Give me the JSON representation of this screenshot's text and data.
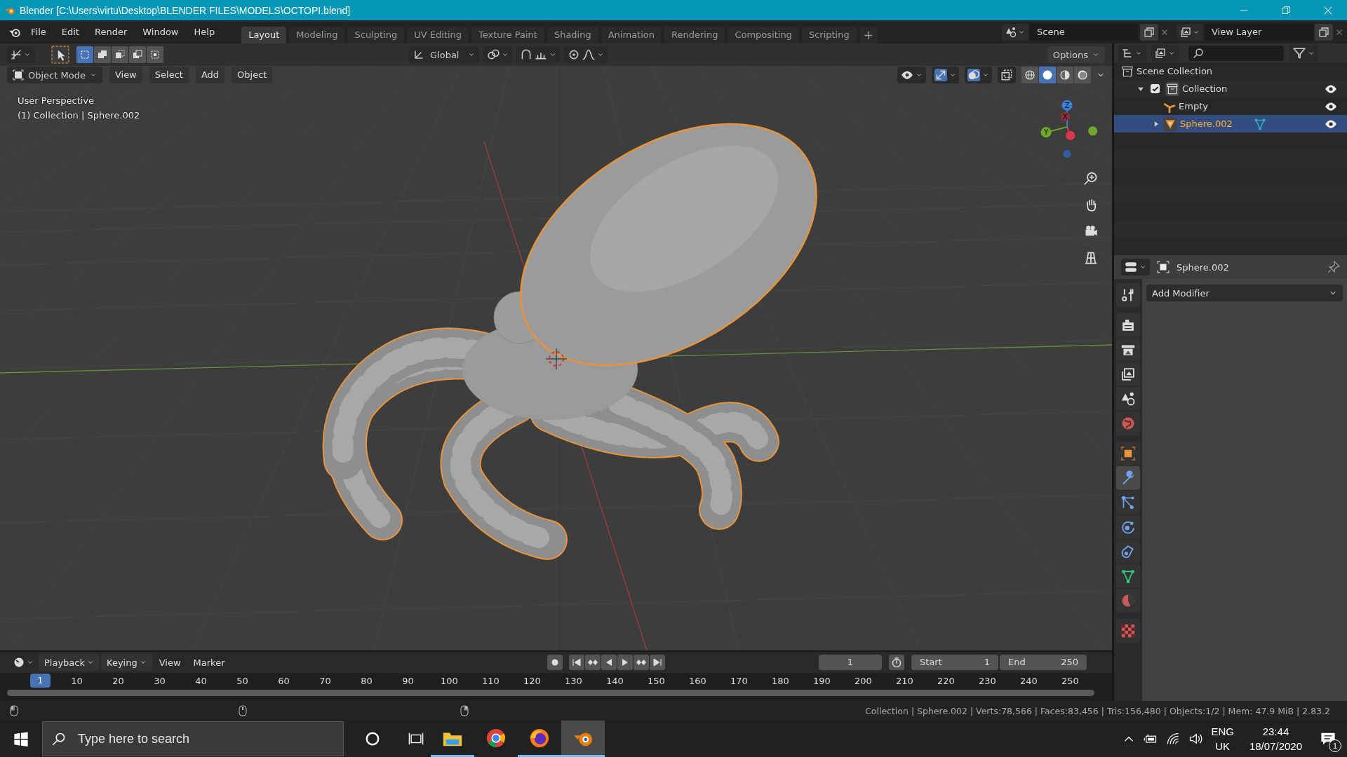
{
  "window": {
    "title": "Blender [C:\\Users\\virtu\\Desktop\\BLENDER FILES\\MODELS\\OCTOPI.blend]"
  },
  "menu": [
    "File",
    "Edit",
    "Render",
    "Window",
    "Help"
  ],
  "workspaces": [
    {
      "label": "Layout",
      "selected": true
    },
    {
      "label": "Modeling",
      "selected": false
    },
    {
      "label": "Sculpting",
      "selected": false
    },
    {
      "label": "UV Editing",
      "selected": false
    },
    {
      "label": "Texture Paint",
      "selected": false
    },
    {
      "label": "Shading",
      "selected": false
    },
    {
      "label": "Animation",
      "selected": false
    },
    {
      "label": "Rendering",
      "selected": false
    },
    {
      "label": "Compositing",
      "selected": false
    },
    {
      "label": "Scripting",
      "selected": false
    }
  ],
  "add_workspace": "+",
  "scene": "Scene",
  "view_layer": "View Layer",
  "tool_header": {
    "select_modes": [
      {
        "kind": "new",
        "selected": true
      },
      {
        "kind": "extend",
        "selected": false
      },
      {
        "kind": "subtract",
        "selected": false
      },
      {
        "kind": "invert",
        "selected": false
      },
      {
        "kind": "intersect",
        "selected": false
      }
    ],
    "orientation": "Global",
    "snap": {
      "on": false
    },
    "proportional": {
      "on": false
    },
    "options": "Options"
  },
  "viewport_header": {
    "mode": "Object Mode",
    "menus": [
      "View",
      "Select",
      "Add",
      "Object"
    ],
    "toggles": [
      {
        "kind": "gizmo",
        "on": true
      },
      {
        "kind": "overlay",
        "on": true
      },
      {
        "kind": "xray",
        "on": false
      }
    ],
    "shading": [
      {
        "kind": "wireframe",
        "selected": false
      },
      {
        "kind": "solid",
        "selected": true
      },
      {
        "kind": "material",
        "selected": false
      },
      {
        "kind": "rendered",
        "selected": false
      }
    ]
  },
  "viewport": {
    "perspective": "User Perspective",
    "context": "(1) Collection | Sphere.002",
    "axes": [
      "Z",
      "X",
      "Y"
    ]
  },
  "outliner": {
    "items": [
      {
        "label": "Scene Collection",
        "kind": "scene",
        "children": [
          {
            "label": "Collection",
            "kind": "collection",
            "expanded": true,
            "checked": true,
            "selected": false,
            "children": [
              {
                "label": "Empty",
                "kind": "empty",
                "selected": false
              },
              {
                "label": "Sphere.002",
                "kind": "mesh",
                "expanded": false,
                "selected": true
              }
            ]
          }
        ]
      }
    ]
  },
  "properties": {
    "object": "Sphere.002",
    "add_modifier": "Add Modifier",
    "tabs": [
      {
        "kind": "tool",
        "selected": false
      },
      {
        "kind": "render",
        "selected": false
      },
      {
        "kind": "output",
        "selected": false
      },
      {
        "kind": "view_layer",
        "selected": false
      },
      {
        "kind": "scene",
        "selected": false
      },
      {
        "kind": "world",
        "selected": false
      },
      {
        "kind": "object",
        "selected": false
      },
      {
        "kind": "modifiers",
        "selected": true
      },
      {
        "kind": "particles",
        "selected": false
      },
      {
        "kind": "physics",
        "selected": false
      },
      {
        "kind": "constraints",
        "selected": false
      },
      {
        "kind": "data",
        "selected": false
      },
      {
        "kind": "material",
        "selected": false
      },
      {
        "kind": "texture",
        "selected": false
      }
    ]
  },
  "timeline": {
    "menus": [
      {
        "label": "Playback",
        "dropdown": true
      },
      {
        "label": "Keying",
        "dropdown": true
      },
      {
        "label": "View",
        "dropdown": false
      },
      {
        "label": "Marker",
        "dropdown": false
      }
    ],
    "current_frame": "1",
    "start_label": "Start",
    "start": "1",
    "end_label": "End",
    "end": "250",
    "ruler_current": "1",
    "ruler": [
      "10",
      "20",
      "30",
      "40",
      "50",
      "60",
      "70",
      "80",
      "90",
      "100",
      "110",
      "120",
      "130",
      "140",
      "150",
      "160",
      "170",
      "180",
      "190",
      "200",
      "210",
      "220",
      "230",
      "240",
      "250"
    ]
  },
  "status_bar": "Collection | Sphere.002 | Verts:78,566 | Faces:83,456 | Tris:156,480 | Objects:1/2 | Mem: 47.9 MiB | 2.83.2",
  "taskbar": {
    "search": {
      "placeholder": "Type here to search"
    },
    "apps": [
      {
        "kind": "explorer",
        "running": true,
        "selected": false
      },
      {
        "kind": "chrome",
        "running": false,
        "selected": false
      },
      {
        "kind": "firefox",
        "running": true,
        "selected": false
      },
      {
        "kind": "blender",
        "running": true,
        "selected": true
      }
    ],
    "language": "ENG",
    "region": "UK",
    "time": "23:44",
    "date": "18/07/2020",
    "notifications": "1"
  }
}
